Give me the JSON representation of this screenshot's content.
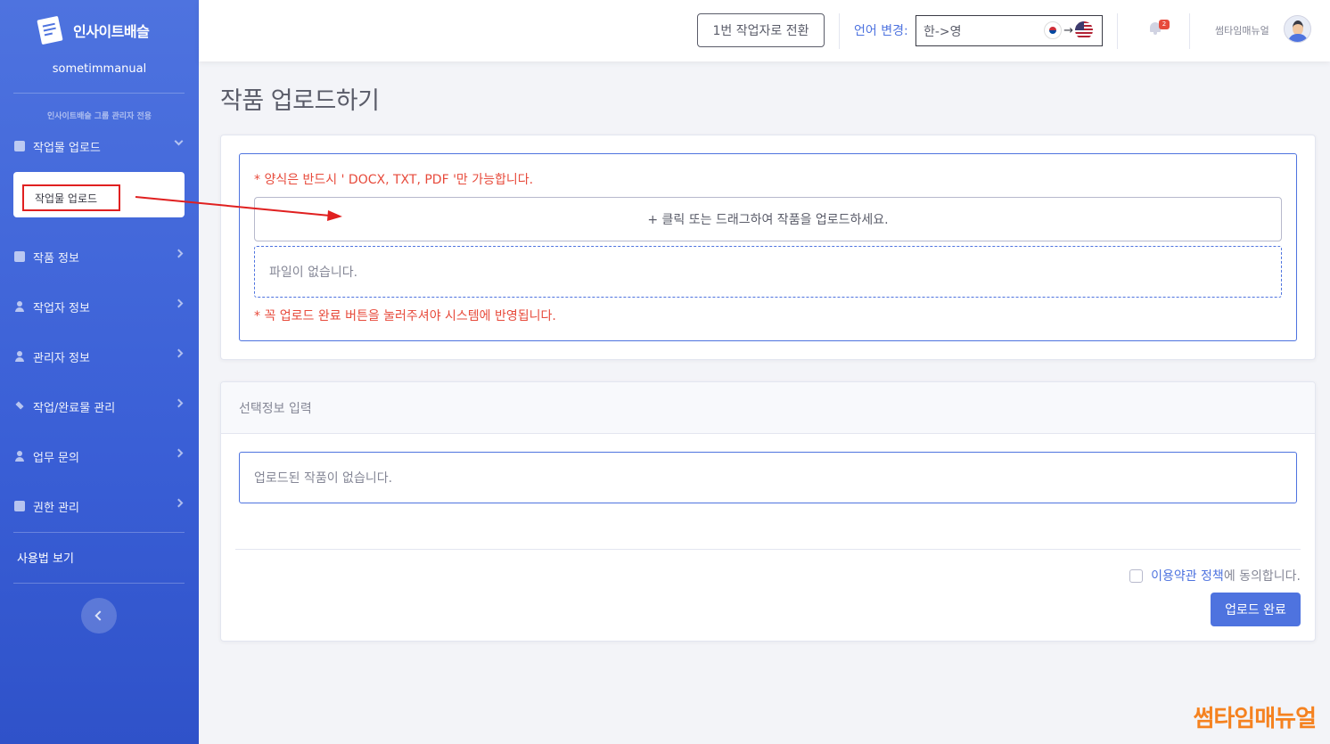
{
  "brand": {
    "name": "인사이트배슬",
    "account": "sometimmanual"
  },
  "sidebar": {
    "heading": "인사이트배슬 그룹 관리자 전용",
    "upload_section": "작업물 업로드",
    "submenu_item": "작업물 업로드",
    "items": [
      {
        "label": "작품 정보",
        "icon": "book-icon"
      },
      {
        "label": "작업자 정보",
        "icon": "user-icon"
      },
      {
        "label": "관리자 정보",
        "icon": "user-icon"
      },
      {
        "label": "작업/완료물 관리",
        "icon": "layers-icon"
      },
      {
        "label": "업무 문의",
        "icon": "users-icon"
      },
      {
        "label": "권한 관리",
        "icon": "file-icon"
      }
    ],
    "usage_link": "사용법 보기"
  },
  "topbar": {
    "switch_label": "1번 작업자로 전환",
    "language_label": "언어 변경:",
    "language_value": "한->영",
    "notification_count": "2",
    "user_name": "썸타임매뉴얼"
  },
  "main": {
    "title": "작품 업로드하기",
    "upload": {
      "format_note": "* 양식은 반드시 ' DOCX, TXT, PDF '만 가능합니다.",
      "drop_label": "+ 클릭 또는 드래그하여 작품을 업로드하세요.",
      "empty_files": "파일이 없습니다.",
      "reminder": "* 꼭 업로드 완료 버튼을 눌러주셔야 시스템에 반영됩니다."
    },
    "optional": {
      "header": "선택정보 입력",
      "empty": "업로드된 작품이 없습니다.",
      "agree_link": "이용약관 정책",
      "agree_tail": "에 동의합니다.",
      "submit": "업로드 완료"
    }
  },
  "watermark": "썸타임매뉴얼",
  "colors": {
    "primary": "#4e73df",
    "danger": "#e74a3b",
    "annotation": "#e02020",
    "watermark": "#f58220"
  }
}
